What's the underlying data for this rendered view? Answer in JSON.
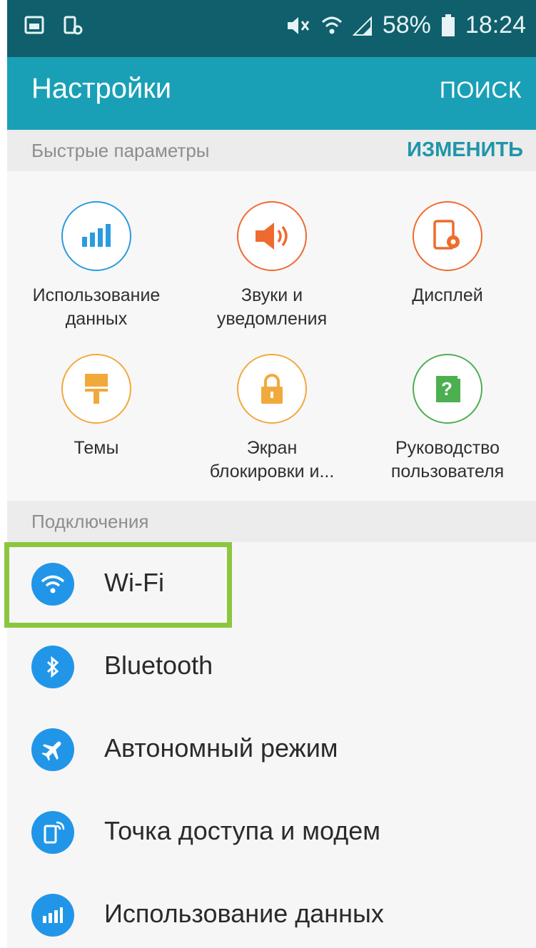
{
  "status_bar": {
    "battery": "58%",
    "time": "18:24",
    "icons": [
      "gallery-icon",
      "screenshot-icon",
      "mute-icon",
      "wifi-signal-icon",
      "cell-signal-icon",
      "battery-icon"
    ]
  },
  "app_bar": {
    "title": "Настройки",
    "search_label": "ПОИСК"
  },
  "quick_settings": {
    "header": "Быстрые параметры",
    "edit_label": "ИЗМЕНИТЬ",
    "items": [
      {
        "line1": "Использование",
        "line2": "данных",
        "icon": "data-usage-icon",
        "color": "#2a9be0"
      },
      {
        "line1": "Звуки и",
        "line2": "уведомления",
        "icon": "speaker-icon",
        "color": "#ef6a2f"
      },
      {
        "line1": "Дисплей",
        "line2": "",
        "icon": "display-icon",
        "color": "#ee6c2c"
      },
      {
        "line1": "Темы",
        "line2": "",
        "icon": "paint-roller-icon",
        "color": "#f2a93b"
      },
      {
        "line1": "Экран",
        "line2": "блокировки и...",
        "icon": "lock-icon",
        "color": "#f2a93b"
      },
      {
        "line1": "Руководство",
        "line2": "пользователя",
        "icon": "help-book-icon",
        "color": "#4caf50"
      }
    ]
  },
  "connections": {
    "header": "Подключения",
    "items": [
      {
        "label": "Wi-Fi",
        "icon": "wifi-icon"
      },
      {
        "label": "Bluetooth",
        "icon": "bluetooth-icon"
      },
      {
        "label": "Автономный режим",
        "icon": "airplane-icon"
      },
      {
        "label": "Точка доступа и модем",
        "icon": "hotspot-icon"
      },
      {
        "label": "Использование данных",
        "icon": "data-usage-icon"
      }
    ]
  },
  "colors": {
    "status_bar": "#0f5f6c",
    "app_bar": "#1aa0b6",
    "accent": "#1f95aa",
    "list_icon": "#2196e8",
    "highlight": "#8cc63f"
  }
}
